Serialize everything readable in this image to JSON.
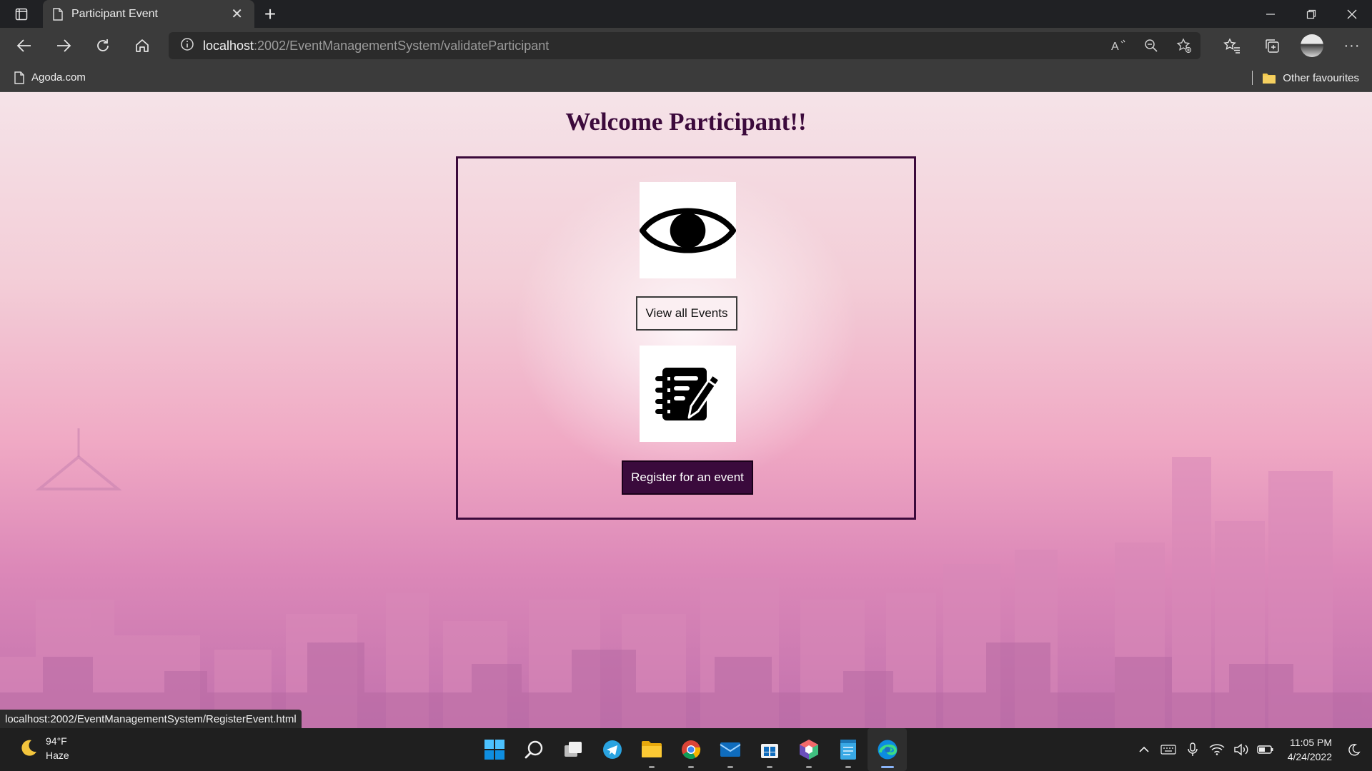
{
  "browser": {
    "tab_title": "Participant Event",
    "url_host": "localhost",
    "url_path": ":2002/EventManagementSystem/validateParticipant",
    "favorites": {
      "left_item": "Agoda.com",
      "right_item": "Other favourites"
    },
    "status_url": "localhost:2002/EventManagementSystem/RegisterEvent.html"
  },
  "page": {
    "title": "Welcome Participant!!",
    "view_button": "View all Events",
    "register_button": "Register for an event",
    "icons": [
      "eye-icon",
      "notes-edit-icon"
    ]
  },
  "taskbar": {
    "weather_temp": "94°F",
    "weather_desc": "Haze",
    "time": "11:05 PM",
    "date": "4/24/2022",
    "apps": [
      "start",
      "search",
      "task-view",
      "telegram",
      "file-explorer",
      "chrome",
      "mail",
      "store",
      "app-cube",
      "notepad",
      "edge"
    ]
  },
  "colors": {
    "title": "#3c0a3c",
    "panel_border": "#3b0a3b",
    "register_bg": "#3a0a3c"
  }
}
